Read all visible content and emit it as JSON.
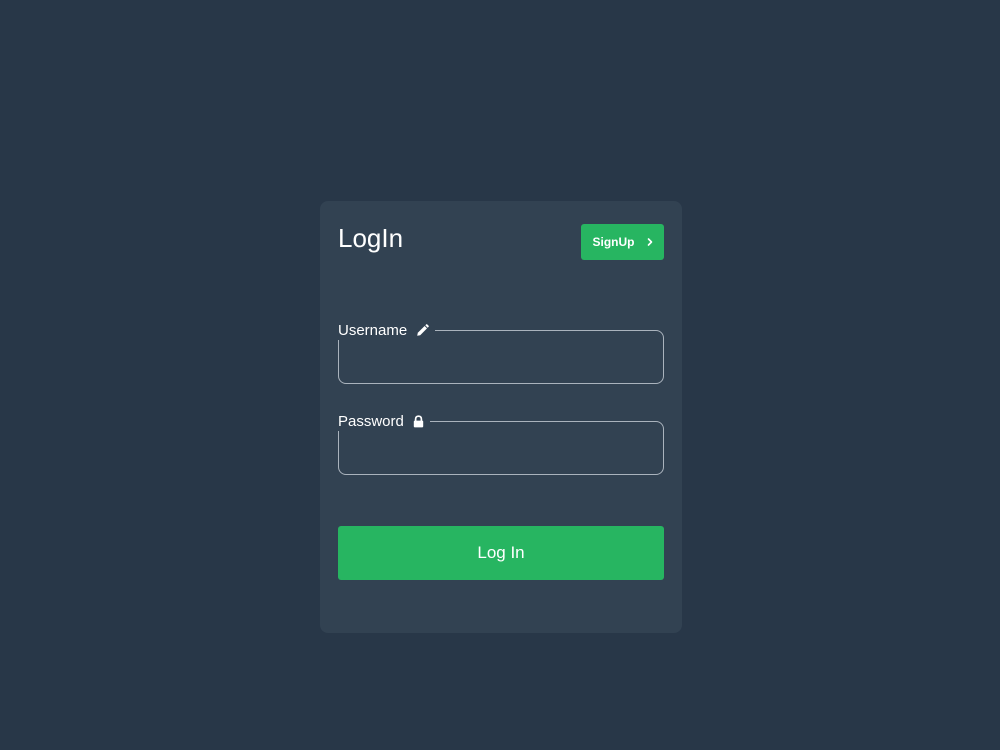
{
  "login_card": {
    "title": "LogIn",
    "signup_button": {
      "label": "SignUp",
      "icon": "chevron-right-icon"
    },
    "username_field": {
      "label": "Username",
      "icon": "pencil-icon",
      "value": "",
      "placeholder": ""
    },
    "password_field": {
      "label": "Password",
      "icon": "lock-icon",
      "value": "",
      "placeholder": ""
    },
    "submit_button": {
      "label": "Log In"
    }
  },
  "colors": {
    "page_background": "#283748",
    "card_background": "#324252",
    "accent_green": "#27b561",
    "field_border": "#aab3bd",
    "text": "#ffffff"
  }
}
